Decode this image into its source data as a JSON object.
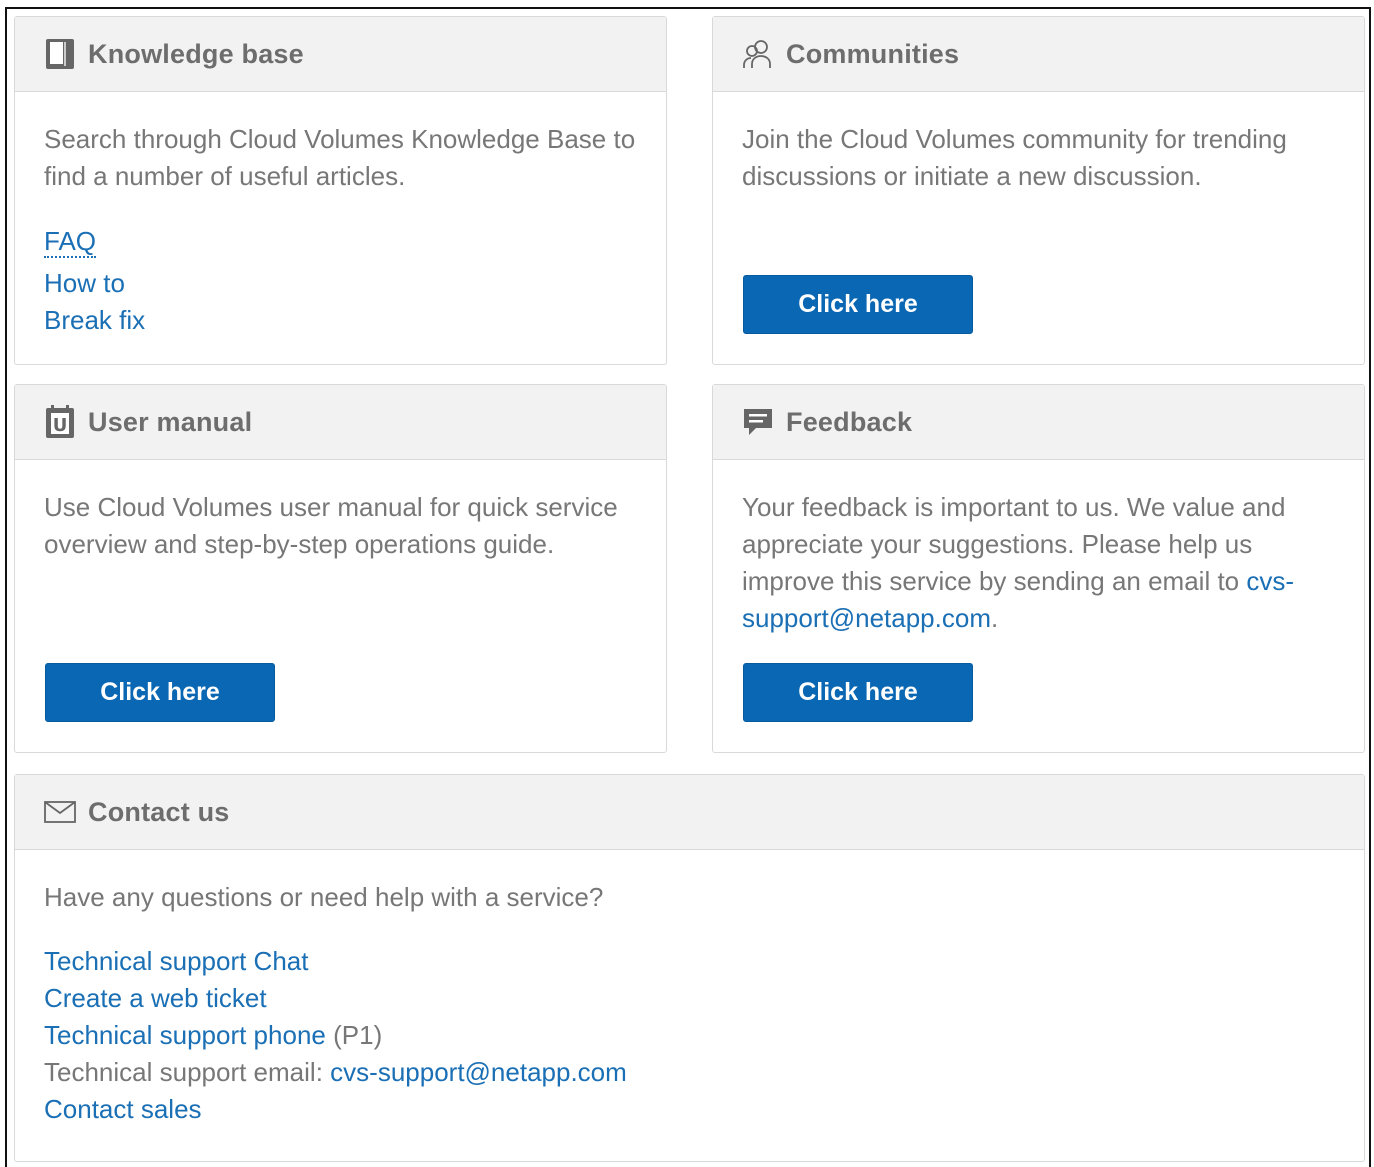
{
  "knowledge_base": {
    "title": "Knowledge base",
    "icon": "book-icon",
    "description": "Search through Cloud Volumes Knowledge Base to find a number of useful articles.",
    "links": [
      "FAQ",
      "How to",
      "Break fix"
    ]
  },
  "communities": {
    "title": "Communities",
    "icon": "users-icon",
    "description": "Join the Cloud Volumes community for trending discussions or initiate a new discussion.",
    "button_label": "Click here"
  },
  "user_manual": {
    "title": "User manual",
    "icon": "manual-icon",
    "description": "Use Cloud Volumes user manual for quick service overview and step-by-step operations guide.",
    "button_label": "Click here"
  },
  "feedback": {
    "title": "Feedback",
    "icon": "feedback-icon",
    "description": "Your feedback is important to us. We value and appreciate your suggestions. Please help us improve this service by sending an email to",
    "email": "cvs-support@netapp.com",
    "period": ".",
    "button_label": "Click here"
  },
  "contact_us": {
    "title": "Contact us",
    "icon": "envelope-icon",
    "question": "Have any questions or need help with a service?",
    "chat_link": "Technical support Chat",
    "ticket_link": "Create a web ticket",
    "phone_link": "Technical support phone",
    "phone_suffix": "(P1)",
    "email_label": "Technical support email:",
    "email": "cvs-support@netapp.com",
    "sales_link": "Contact sales"
  },
  "colors": {
    "accent": "#0a67b3",
    "link": "#1a6fb5",
    "header_bg": "#f2f2f2"
  }
}
